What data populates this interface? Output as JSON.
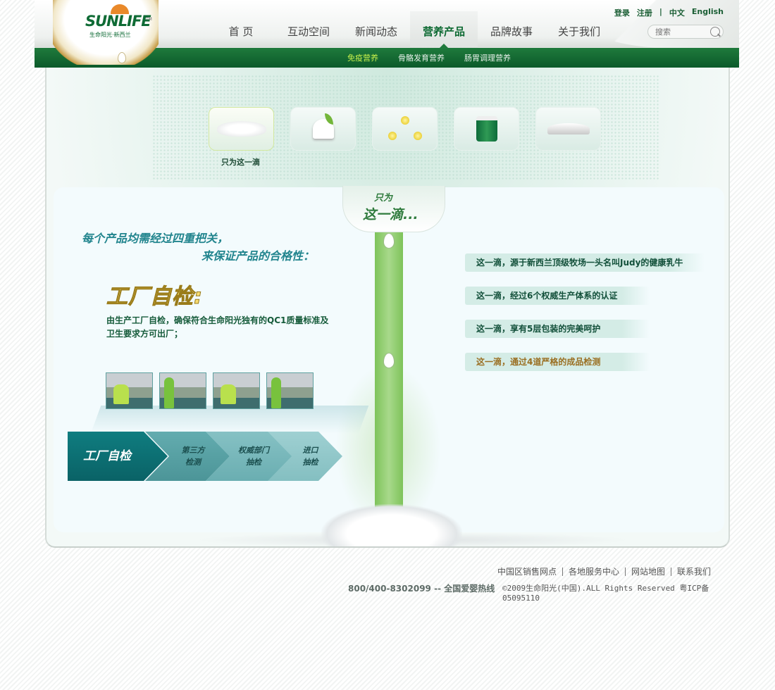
{
  "header": {
    "logo_text": "SUNLIFE",
    "logo_sub": "生命阳光·新西兰",
    "logo_tm": "TM",
    "top_links": [
      "登录",
      "注册",
      "|",
      "中文",
      "English"
    ],
    "search_placeholder": "搜索",
    "nav": [
      "首 页",
      "互动空间",
      "新闻动态",
      "营养产品",
      "品牌故事",
      "关于我们"
    ],
    "nav_active": "营养产品",
    "subnav": [
      "免疫营养",
      "骨骼发育营养",
      "肠胃调理营养"
    ],
    "subnav_active": "免疫营养"
  },
  "icons": {
    "tiles": [
      "milk-splash-icon",
      "heart-sprout-icon",
      "molecule-icon",
      "milk-can-icon",
      "book-icon"
    ],
    "active_label": "只为这一滴"
  },
  "card": {
    "tab_line1": "只为",
    "tab_line2": "这一滴...",
    "headline_line1": "每个产品均需经过四重把关，",
    "headline_line2": "来保证产品的合格性：",
    "title": "工厂自检:",
    "description": "由生产工厂自检，确保符合生命阳光独有的QC1质量标准及卫生要求方可出厂；",
    "steps": [
      "工厂自检",
      "第三方\n检测",
      "权威部门\n抽检",
      "进口\n抽检"
    ],
    "list": [
      "这一滴，源于新西兰顶级牧场一头名叫Judy的健康乳牛",
      "这一滴，经过6个权威生产体系的认证",
      "这一滴，享有5层包装的完美呵护",
      "这一滴，通过4道严格的成品检测"
    ]
  },
  "footer": {
    "links": [
      "中国区销售网点",
      "各地服务中心",
      "网站地图",
      "联系我们"
    ],
    "hotline": "800/400-8302099 -- 全国爱婴热线",
    "copyright": "©2009生命阳光(中国).ALL Rights Reserved  粤ICP备05095110"
  },
  "colors": {
    "brand_green": "#0e6a33",
    "accent_teal": "#22858e",
    "step_dark": "#0f7d80",
    "highlight_yellow_green": "#c7f04c"
  }
}
